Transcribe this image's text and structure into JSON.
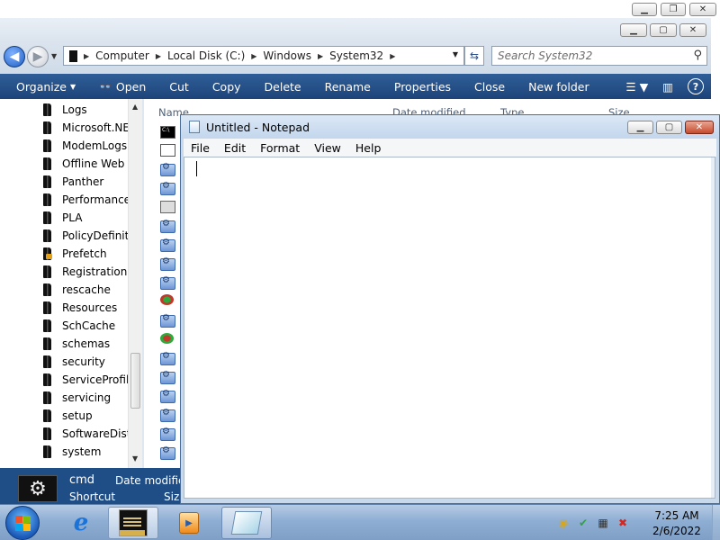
{
  "explorer": {
    "address": [
      "Computer",
      "Local Disk (C:)",
      "Windows",
      "System32"
    ],
    "search_placeholder": "Search System32",
    "toolbar": [
      "Organize",
      "Open",
      "Cut",
      "Copy",
      "Delete",
      "Rename",
      "Properties",
      "Close",
      "New folder"
    ],
    "organize_label": "Organize",
    "open_label": "Open",
    "nav_items": [
      {
        "label": "Logs"
      },
      {
        "label": "Microsoft.NET"
      },
      {
        "label": "ModemLogs"
      },
      {
        "label": "Offline Web Pages"
      },
      {
        "label": "Panther"
      },
      {
        "label": "Performance"
      },
      {
        "label": "PLA"
      },
      {
        "label": "PolicyDefinitions"
      },
      {
        "label": "Prefetch"
      },
      {
        "label": "Registration"
      },
      {
        "label": "rescache"
      },
      {
        "label": "Resources"
      },
      {
        "label": "SchCache"
      },
      {
        "label": "schemas"
      },
      {
        "label": "security"
      },
      {
        "label": "ServiceProfiles"
      },
      {
        "label": "servicing"
      },
      {
        "label": "setup"
      },
      {
        "label": "SoftwareDistribution"
      },
      {
        "label": "system"
      }
    ],
    "columns": [
      "Name",
      "Date modified",
      "Type",
      "Size"
    ],
    "details": {
      "name": "cmd",
      "date_label": "Date modified",
      "type": "Shortcut",
      "size_label": "Size"
    }
  },
  "notepad": {
    "title": "Untitled - Notepad",
    "menu": [
      "File",
      "Edit",
      "Format",
      "View",
      "Help"
    ]
  },
  "taskbar": {
    "time": "7:25 AM",
    "date": "2/6/2022"
  }
}
